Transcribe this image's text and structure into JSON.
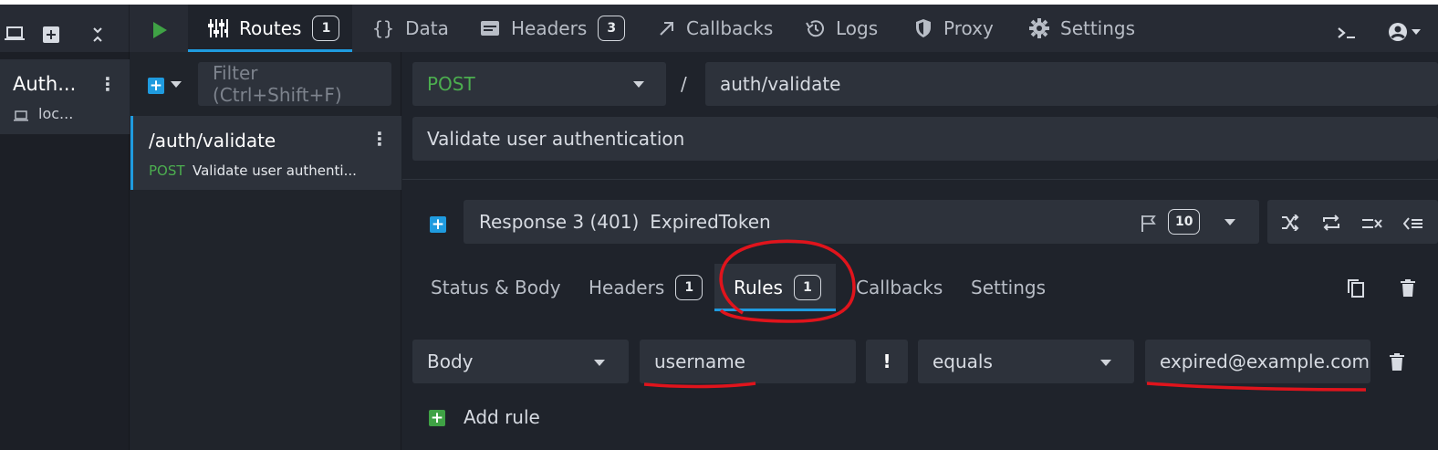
{
  "topbar": {
    "tabs": [
      {
        "label": "Routes",
        "badge": "1",
        "icon": "sliders-icon"
      },
      {
        "label": "Data",
        "icon": "braces-icon"
      },
      {
        "label": "Headers",
        "badge": "3",
        "icon": "window-icon"
      },
      {
        "label": "Callbacks",
        "icon": "arrow-up-right-icon"
      },
      {
        "label": "Logs",
        "icon": "history-icon"
      },
      {
        "label": "Proxy",
        "icon": "shield-icon"
      },
      {
        "label": "Settings",
        "icon": "gear-icon"
      }
    ]
  },
  "environment": {
    "name": "Auth...",
    "host": "loc..."
  },
  "routes": {
    "filter_placeholder": "Filter (Ctrl+Shift+F)",
    "items": [
      {
        "path": "/auth/validate",
        "method": "POST",
        "description": "Validate user authenti..."
      }
    ]
  },
  "route": {
    "method": "POST",
    "separator": "/",
    "path": "auth/validate",
    "documentation": "Validate user authentication"
  },
  "response": {
    "label": "Response 3 (401)",
    "name": "ExpiredToken",
    "count": "10"
  },
  "subtabs": [
    {
      "label": "Status & Body"
    },
    {
      "label": "Headers",
      "badge": "1"
    },
    {
      "label": "Rules",
      "badge": "1"
    },
    {
      "label": "Callbacks"
    },
    {
      "label": "Settings"
    }
  ],
  "rule": {
    "target": "Body",
    "property": "username",
    "negate": "!",
    "operator": "equals",
    "value": "expired@example.com"
  },
  "add_rule_label": "Add rule",
  "colors": {
    "accent": "#1f9bdf",
    "method_green": "#4cae4f",
    "annotation_red": "#e0141c"
  }
}
